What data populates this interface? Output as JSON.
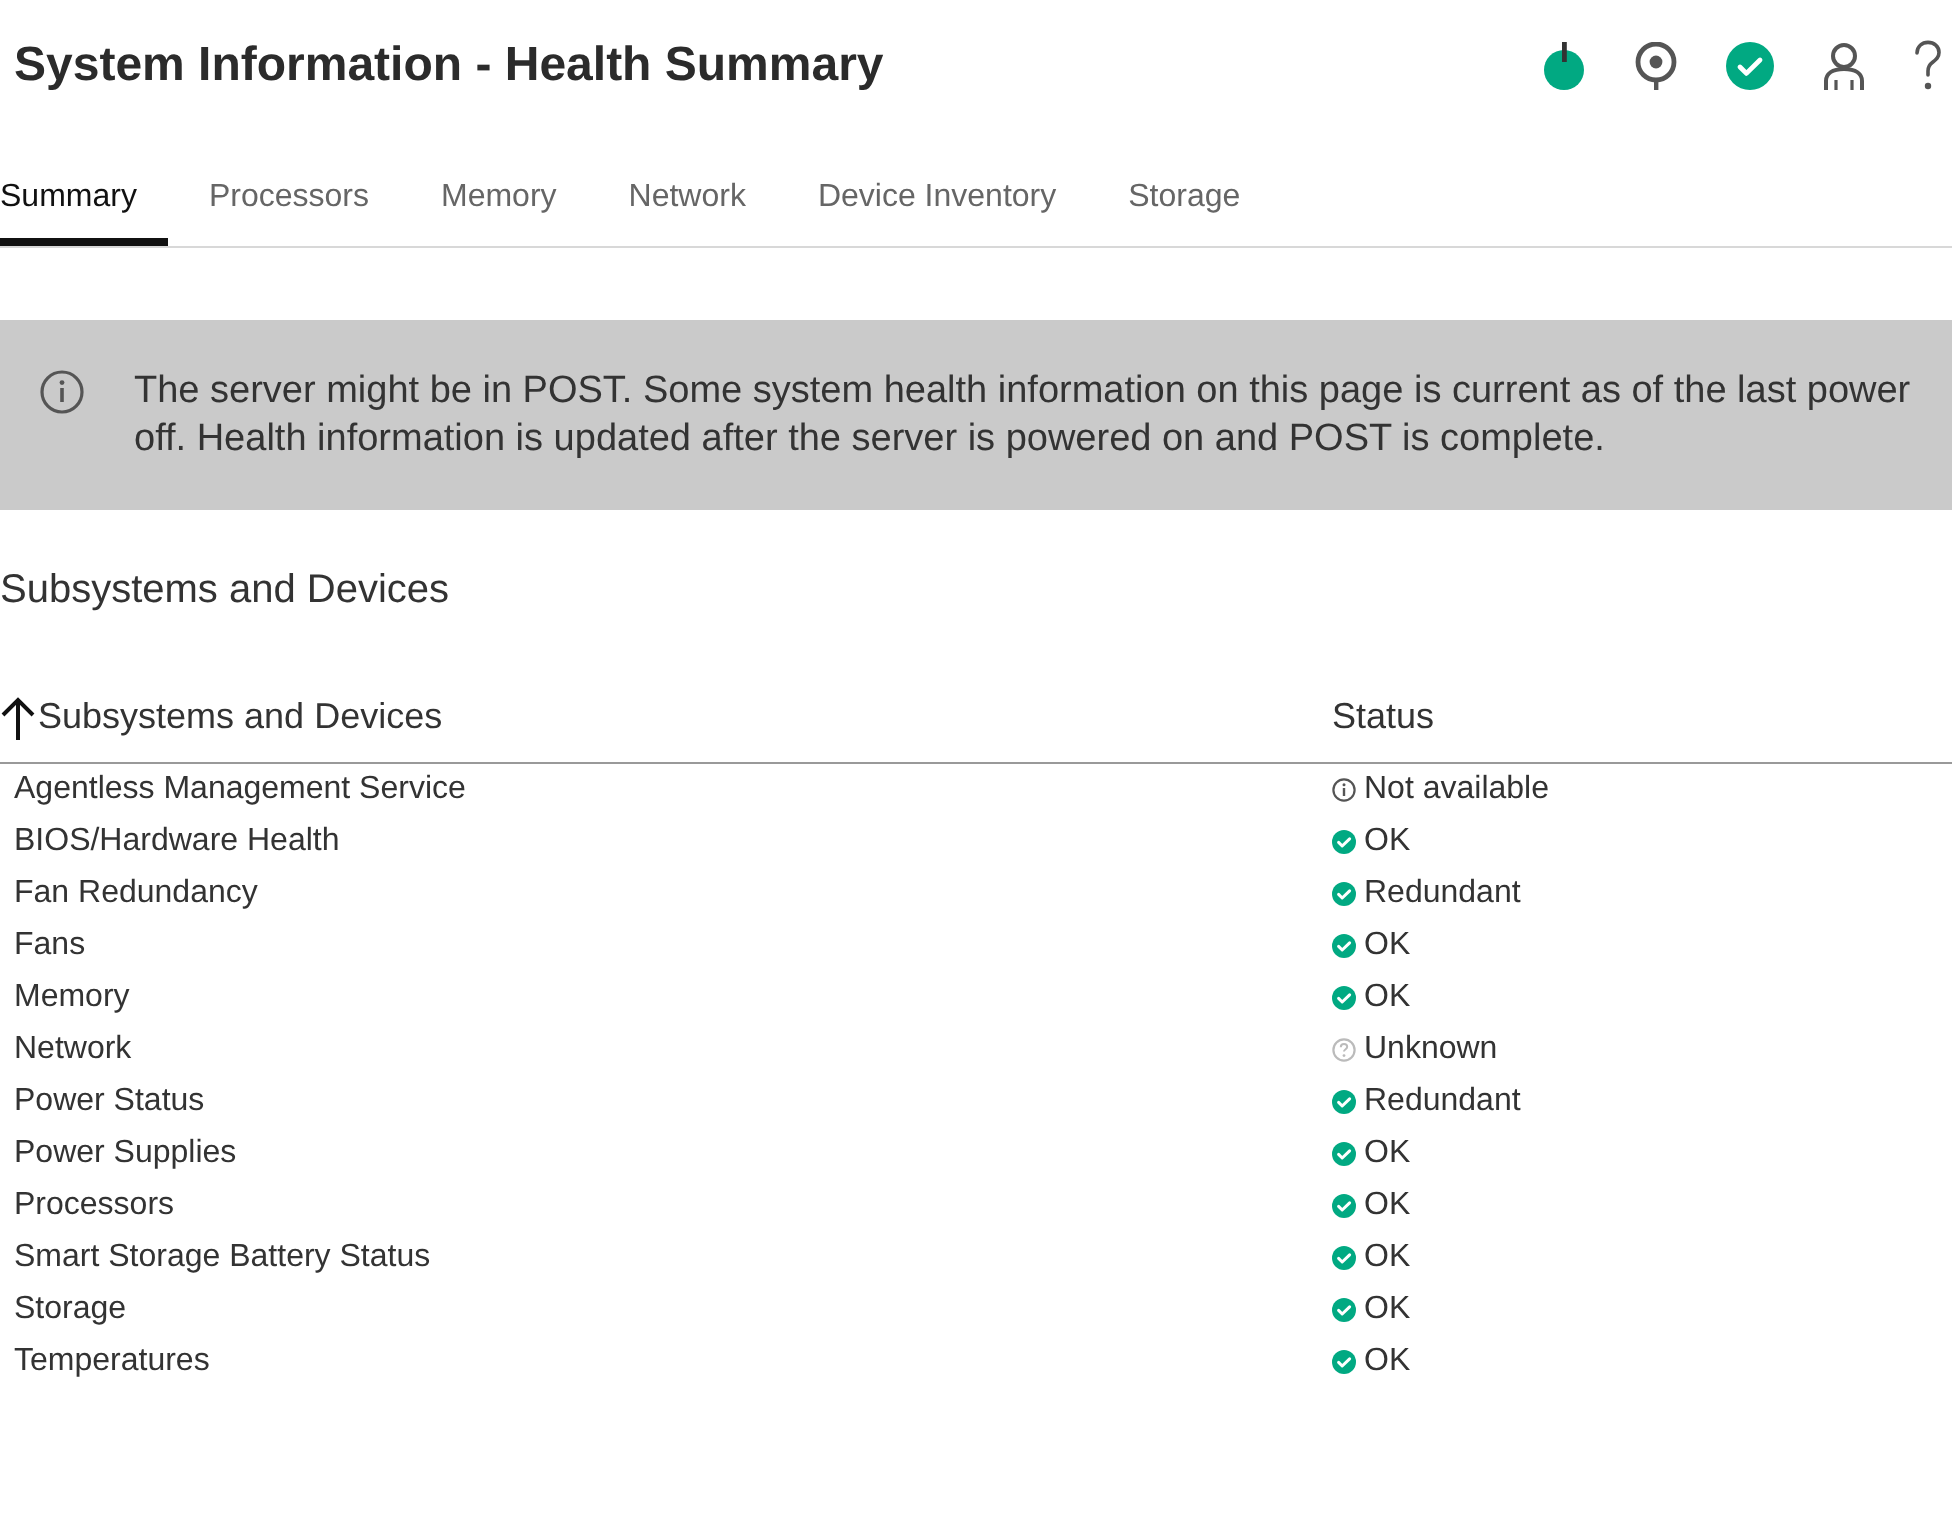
{
  "header": {
    "title": "System Information - Health Summary",
    "icons": [
      {
        "kind": "power",
        "on": true
      },
      {
        "kind": "locator"
      },
      {
        "kind": "health",
        "healthy": true
      },
      {
        "kind": "user"
      },
      {
        "kind": "help"
      }
    ]
  },
  "tabs": [
    {
      "label": "Summary",
      "selected": true
    },
    {
      "label": "Processors",
      "selected": false
    },
    {
      "label": "Memory",
      "selected": false
    },
    {
      "label": "Network",
      "selected": false
    },
    {
      "label": "Device Inventory",
      "selected": false
    },
    {
      "label": "Storage",
      "selected": false
    }
  ],
  "notice": {
    "text": "The server might be in POST. Some system health information on this page is current as of the last power off. Health information is updated after the server is powered on and POST is complete."
  },
  "section": {
    "title": "Subsystems and Devices"
  },
  "table": {
    "columns": [
      {
        "label": "Subsystems and Devices",
        "sorted": true,
        "sort_ascending": true
      },
      {
        "label": "Status",
        "sorted": false
      }
    ],
    "rows": [
      {
        "name": "Agentless Management Service",
        "status": {
          "kind": "info",
          "label": "Not available"
        }
      },
      {
        "name": "BIOS/Hardware Health",
        "status": {
          "kind": "ok",
          "label": "OK"
        }
      },
      {
        "name": "Fan Redundancy",
        "status": {
          "kind": "ok",
          "label": "Redundant"
        }
      },
      {
        "name": "Fans",
        "status": {
          "kind": "ok",
          "label": "OK"
        }
      },
      {
        "name": "Memory",
        "status": {
          "kind": "ok",
          "label": "OK"
        }
      },
      {
        "name": "Network",
        "status": {
          "kind": "unknown",
          "label": "Unknown"
        }
      },
      {
        "name": "Power Status",
        "status": {
          "kind": "ok",
          "label": "Redundant"
        }
      },
      {
        "name": "Power Supplies",
        "status": {
          "kind": "ok",
          "label": "OK"
        }
      },
      {
        "name": "Processors",
        "status": {
          "kind": "ok",
          "label": "OK"
        }
      },
      {
        "name": "Smart Storage Battery Status",
        "status": {
          "kind": "ok",
          "label": "OK"
        }
      },
      {
        "name": "Storage",
        "status": {
          "kind": "ok",
          "label": "OK"
        }
      },
      {
        "name": "Temperatures",
        "status": {
          "kind": "ok",
          "label": "OK"
        }
      }
    ]
  }
}
